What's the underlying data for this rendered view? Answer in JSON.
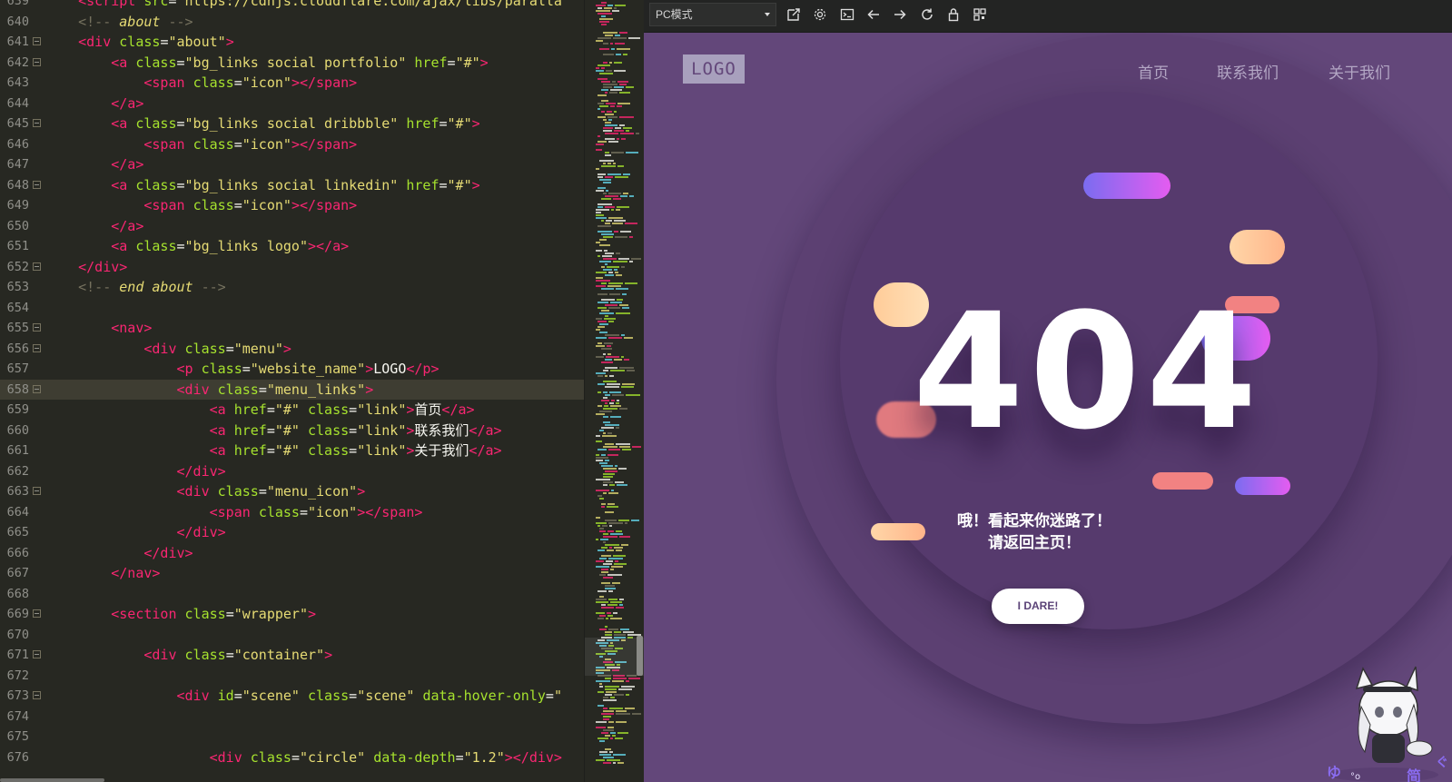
{
  "editor": {
    "lines": [
      {
        "n": "639",
        "fold": false,
        "tokens": [
          [
            "i4",
            ""
          ],
          [
            "tag",
            "<script "
          ],
          [
            "attr",
            "src"
          ],
          [
            "pun",
            "="
          ],
          [
            "str",
            "\"https://cdnjs.cloudflare.com/ajax/libs/paralla"
          ]
        ]
      },
      {
        "n": "640",
        "fold": false,
        "tokens": [
          [
            "i4",
            ""
          ],
          [
            "cmt",
            "<!-- "
          ],
          [
            "cmti",
            "about"
          ],
          [
            "cmt",
            " -->"
          ]
        ]
      },
      {
        "n": "641",
        "fold": true,
        "tokens": [
          [
            "i4",
            ""
          ],
          [
            "tag",
            "<div "
          ],
          [
            "attr",
            "class"
          ],
          [
            "pun",
            "="
          ],
          [
            "str",
            "\"about\""
          ],
          [
            "tag",
            ">"
          ]
        ]
      },
      {
        "n": "642",
        "fold": true,
        "tokens": [
          [
            "i8",
            ""
          ],
          [
            "tag",
            "<a "
          ],
          [
            "attr",
            "class"
          ],
          [
            "pun",
            "="
          ],
          [
            "str",
            "\"bg_links social portfolio\" "
          ],
          [
            "attr",
            "href"
          ],
          [
            "pun",
            "="
          ],
          [
            "str",
            "\"#\""
          ],
          [
            "tag",
            ">"
          ]
        ]
      },
      {
        "n": "643",
        "fold": false,
        "tokens": [
          [
            "i12",
            ""
          ],
          [
            "tag",
            "<span "
          ],
          [
            "attr",
            "class"
          ],
          [
            "pun",
            "="
          ],
          [
            "str",
            "\"icon\""
          ],
          [
            "tag",
            "></span>"
          ]
        ]
      },
      {
        "n": "644",
        "fold": false,
        "tokens": [
          [
            "i8",
            ""
          ],
          [
            "tag",
            "</a>"
          ]
        ]
      },
      {
        "n": "645",
        "fold": true,
        "tokens": [
          [
            "i8",
            ""
          ],
          [
            "tag",
            "<a "
          ],
          [
            "attr",
            "class"
          ],
          [
            "pun",
            "="
          ],
          [
            "str",
            "\"bg_links social dribbble\" "
          ],
          [
            "attr",
            "href"
          ],
          [
            "pun",
            "="
          ],
          [
            "str",
            "\"#\""
          ],
          [
            "tag",
            ">"
          ]
        ]
      },
      {
        "n": "646",
        "fold": false,
        "tokens": [
          [
            "i12",
            ""
          ],
          [
            "tag",
            "<span "
          ],
          [
            "attr",
            "class"
          ],
          [
            "pun",
            "="
          ],
          [
            "str",
            "\"icon\""
          ],
          [
            "tag",
            "></span>"
          ]
        ]
      },
      {
        "n": "647",
        "fold": false,
        "tokens": [
          [
            "i8",
            ""
          ],
          [
            "tag",
            "</a>"
          ]
        ]
      },
      {
        "n": "648",
        "fold": true,
        "tokens": [
          [
            "i8",
            ""
          ],
          [
            "tag",
            "<a "
          ],
          [
            "attr",
            "class"
          ],
          [
            "pun",
            "="
          ],
          [
            "str",
            "\"bg_links social linkedin\" "
          ],
          [
            "attr",
            "href"
          ],
          [
            "pun",
            "="
          ],
          [
            "str",
            "\"#\""
          ],
          [
            "tag",
            ">"
          ]
        ]
      },
      {
        "n": "649",
        "fold": false,
        "tokens": [
          [
            "i12",
            ""
          ],
          [
            "tag",
            "<span "
          ],
          [
            "attr",
            "class"
          ],
          [
            "pun",
            "="
          ],
          [
            "str",
            "\"icon\""
          ],
          [
            "tag",
            "></span>"
          ]
        ]
      },
      {
        "n": "650",
        "fold": false,
        "tokens": [
          [
            "i8",
            ""
          ],
          [
            "tag",
            "</a>"
          ]
        ]
      },
      {
        "n": "651",
        "fold": false,
        "tokens": [
          [
            "i8",
            ""
          ],
          [
            "tag",
            "<a "
          ],
          [
            "attr",
            "class"
          ],
          [
            "pun",
            "="
          ],
          [
            "str",
            "\"bg_links logo\""
          ],
          [
            "tag",
            "></a>"
          ]
        ]
      },
      {
        "n": "652",
        "fold": true,
        "tokens": [
          [
            "i4",
            ""
          ],
          [
            "tag",
            "</div>"
          ]
        ]
      },
      {
        "n": "653",
        "fold": false,
        "tokens": [
          [
            "i4",
            ""
          ],
          [
            "cmt",
            "<!-- "
          ],
          [
            "cmti",
            "end about"
          ],
          [
            "cmt",
            " -->"
          ]
        ]
      },
      {
        "n": "654",
        "fold": false,
        "tokens": []
      },
      {
        "n": "655",
        "fold": true,
        "tokens": [
          [
            "i8",
            ""
          ],
          [
            "tag",
            "<nav>"
          ]
        ]
      },
      {
        "n": "656",
        "fold": true,
        "tokens": [
          [
            "i12",
            ""
          ],
          [
            "tag",
            "<div "
          ],
          [
            "attr",
            "class"
          ],
          [
            "pun",
            "="
          ],
          [
            "str",
            "\"menu\""
          ],
          [
            "tag",
            ">"
          ]
        ]
      },
      {
        "n": "657",
        "fold": false,
        "tokens": [
          [
            "i16",
            ""
          ],
          [
            "tag",
            "<p "
          ],
          [
            "attr",
            "class"
          ],
          [
            "pun",
            "="
          ],
          [
            "str",
            "\"website_name\""
          ],
          [
            "tag",
            ">"
          ],
          [
            "txt",
            "LOGO"
          ],
          [
            "tag",
            "</p>"
          ]
        ]
      },
      {
        "n": "658",
        "fold": true,
        "active": true,
        "tokens": [
          [
            "i16",
            ""
          ],
          [
            "tag",
            "<div "
          ],
          [
            "attr",
            "class"
          ],
          [
            "pun",
            "="
          ],
          [
            "str",
            "\"menu_links\""
          ],
          [
            "tag",
            ">"
          ]
        ]
      },
      {
        "n": "659",
        "fold": false,
        "tokens": [
          [
            "i20",
            ""
          ],
          [
            "tag",
            "<a "
          ],
          [
            "attr",
            "href"
          ],
          [
            "pun",
            "="
          ],
          [
            "str",
            "\"#\" "
          ],
          [
            "attr",
            "class"
          ],
          [
            "pun",
            "="
          ],
          [
            "str",
            "\"link\""
          ],
          [
            "tag",
            ">"
          ],
          [
            "txt",
            "首页"
          ],
          [
            "tag",
            "</a>"
          ]
        ]
      },
      {
        "n": "660",
        "fold": false,
        "tokens": [
          [
            "i20",
            ""
          ],
          [
            "tag",
            "<a "
          ],
          [
            "attr",
            "href"
          ],
          [
            "pun",
            "="
          ],
          [
            "str",
            "\"#\" "
          ],
          [
            "attr",
            "class"
          ],
          [
            "pun",
            "="
          ],
          [
            "str",
            "\"link\""
          ],
          [
            "tag",
            ">"
          ],
          [
            "txt",
            "联系我们"
          ],
          [
            "tag",
            "</a>"
          ]
        ]
      },
      {
        "n": "661",
        "fold": false,
        "tokens": [
          [
            "i20",
            ""
          ],
          [
            "tag",
            "<a "
          ],
          [
            "attr",
            "href"
          ],
          [
            "pun",
            "="
          ],
          [
            "str",
            "\"#\" "
          ],
          [
            "attr",
            "class"
          ],
          [
            "pun",
            "="
          ],
          [
            "str",
            "\"link\""
          ],
          [
            "tag",
            ">"
          ],
          [
            "txt",
            "关于我们"
          ],
          [
            "tag",
            "</a>"
          ]
        ]
      },
      {
        "n": "662",
        "fold": false,
        "tokens": [
          [
            "i16",
            ""
          ],
          [
            "tag",
            "</div>"
          ]
        ]
      },
      {
        "n": "663",
        "fold": true,
        "tokens": [
          [
            "i16",
            ""
          ],
          [
            "tag",
            "<div "
          ],
          [
            "attr",
            "class"
          ],
          [
            "pun",
            "="
          ],
          [
            "str",
            "\"menu_icon\""
          ],
          [
            "tag",
            ">"
          ]
        ]
      },
      {
        "n": "664",
        "fold": false,
        "tokens": [
          [
            "i20",
            ""
          ],
          [
            "tag",
            "<span "
          ],
          [
            "attr",
            "class"
          ],
          [
            "pun",
            "="
          ],
          [
            "str",
            "\"icon\""
          ],
          [
            "tag",
            "></span>"
          ]
        ]
      },
      {
        "n": "665",
        "fold": false,
        "tokens": [
          [
            "i16",
            ""
          ],
          [
            "tag",
            "</div>"
          ]
        ]
      },
      {
        "n": "666",
        "fold": false,
        "tokens": [
          [
            "i12",
            ""
          ],
          [
            "tag",
            "</div>"
          ]
        ]
      },
      {
        "n": "667",
        "fold": false,
        "tokens": [
          [
            "i8",
            ""
          ],
          [
            "tag",
            "</nav>"
          ]
        ]
      },
      {
        "n": "668",
        "fold": false,
        "tokens": []
      },
      {
        "n": "669",
        "fold": true,
        "tokens": [
          [
            "i8",
            ""
          ],
          [
            "tag",
            "<section "
          ],
          [
            "attr",
            "class"
          ],
          [
            "pun",
            "="
          ],
          [
            "str",
            "\"wrapper\""
          ],
          [
            "tag",
            ">"
          ]
        ]
      },
      {
        "n": "670",
        "fold": false,
        "tokens": []
      },
      {
        "n": "671",
        "fold": true,
        "tokens": [
          [
            "i12",
            ""
          ],
          [
            "tag",
            "<div "
          ],
          [
            "attr",
            "class"
          ],
          [
            "pun",
            "="
          ],
          [
            "str",
            "\"container\""
          ],
          [
            "tag",
            ">"
          ]
        ]
      },
      {
        "n": "672",
        "fold": false,
        "tokens": []
      },
      {
        "n": "673",
        "fold": true,
        "tokens": [
          [
            "i16",
            ""
          ],
          [
            "tag",
            "<div "
          ],
          [
            "attr",
            "id"
          ],
          [
            "pun",
            "="
          ],
          [
            "str",
            "\"scene\" "
          ],
          [
            "attr",
            "class"
          ],
          [
            "pun",
            "="
          ],
          [
            "str",
            "\"scene\" "
          ],
          [
            "attr",
            "data-hover-only"
          ],
          [
            "pun",
            "="
          ],
          [
            "str",
            "\""
          ]
        ]
      },
      {
        "n": "674",
        "fold": false,
        "tokens": []
      },
      {
        "n": "675",
        "fold": false,
        "tokens": []
      },
      {
        "n": "676",
        "fold": false,
        "tokens": [
          [
            "i20",
            ""
          ],
          [
            "tag",
            "<div "
          ],
          [
            "attr",
            "class"
          ],
          [
            "pun",
            "="
          ],
          [
            "str",
            "\"circle\" "
          ],
          [
            "attr",
            "data-depth"
          ],
          [
            "pun",
            "="
          ],
          [
            "str",
            "\"1.2\""
          ],
          [
            "tag",
            "></div>"
          ]
        ]
      }
    ]
  },
  "toolbar": {
    "mode_value": "PC模式",
    "buttons": [
      {
        "name": "open-external-icon",
        "glyph": "ext"
      },
      {
        "name": "settings-gear-icon",
        "glyph": "gear"
      },
      {
        "name": "console-icon",
        "glyph": "console"
      },
      {
        "name": "back-arrow-icon",
        "glyph": "left"
      },
      {
        "name": "forward-arrow-icon",
        "glyph": "right"
      },
      {
        "name": "refresh-icon",
        "glyph": "refresh"
      },
      {
        "name": "lock-icon",
        "glyph": "lock"
      },
      {
        "name": "qr-code-icon",
        "glyph": "qr"
      }
    ]
  },
  "page": {
    "logo": "LOGO",
    "nav": {
      "home": "首页",
      "contact": "联系我们",
      "about": "关于我们"
    },
    "error_code": "404",
    "message_line1": "哦！看起来你迷路了！",
    "message_line2": "请返回主页！",
    "cta_label": "I DARE!",
    "colors": {
      "background": "#63477a",
      "accent_pink": "#e45cf0",
      "accent_blue": "#7b6cf0",
      "peach": "#ffcc99",
      "coral": "#f28282"
    }
  }
}
